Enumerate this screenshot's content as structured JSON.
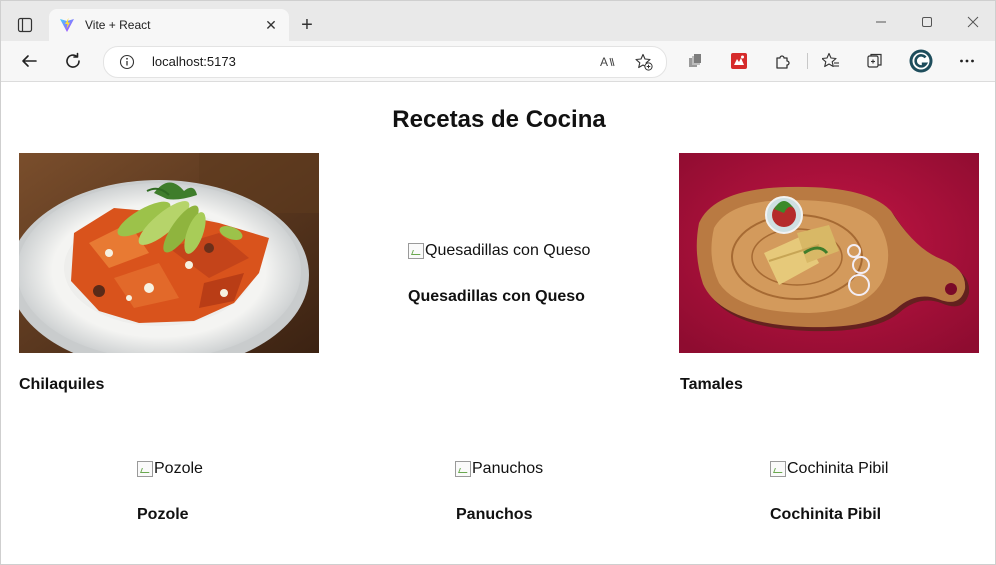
{
  "browser": {
    "tab": {
      "title": "Vite + React",
      "favicon": "vite-logo-icon",
      "close_glyph": "✕"
    },
    "new_tab_glyph": "+",
    "address": {
      "url": "localhost:5173",
      "read_aloud": "Aᴀ"
    }
  },
  "page": {
    "title": "Recetas de Cocina",
    "recipes": [
      {
        "name": "Chilaquiles",
        "alt": "Chilaquiles",
        "image_loaded": true
      },
      {
        "name": "Quesadillas con Queso",
        "alt": "Quesadillas con Queso",
        "image_loaded": false
      },
      {
        "name": "Tamales",
        "alt": "Tamales",
        "image_loaded": true
      },
      {
        "name": "Pozole",
        "alt": "Pozole",
        "image_loaded": false
      },
      {
        "name": "Panuchos",
        "alt": "Panuchos",
        "image_loaded": false
      },
      {
        "name": "Cochinita Pibil",
        "alt": "Cochinita Pibil",
        "image_loaded": false
      }
    ]
  },
  "colors": {
    "tamales_background": "#b0103d",
    "chilaquiles_sauce": "#d9531c",
    "avocado": "#9cc24a"
  }
}
